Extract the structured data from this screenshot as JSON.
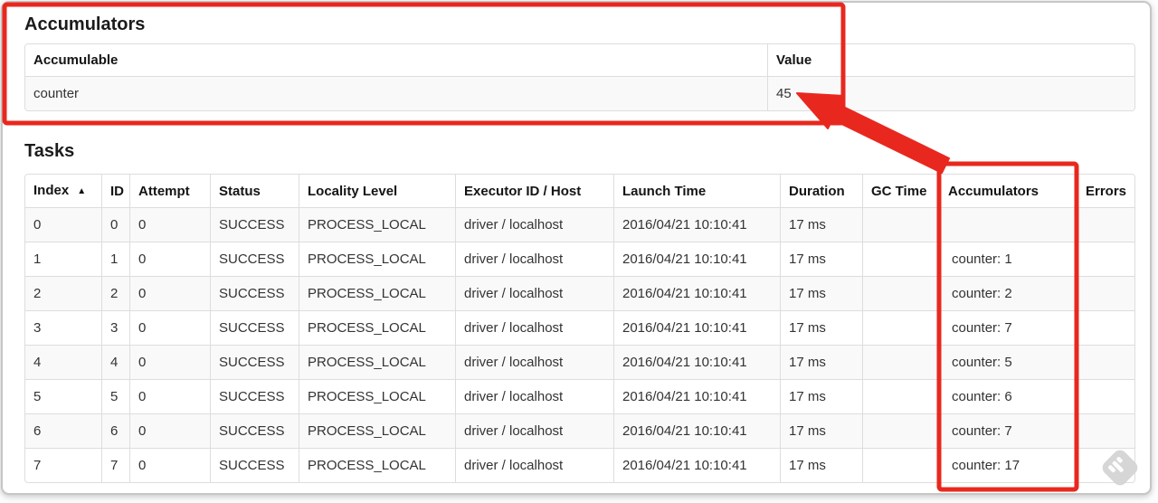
{
  "annotation": {
    "color": "#e8281e"
  },
  "watermark": {
    "name": "skitch-watermark"
  },
  "accumulators_section": {
    "heading": "Accumulators",
    "table": {
      "headers": {
        "accumulable": "Accumulable",
        "value": "Value"
      },
      "rows": [
        {
          "accumulable": "counter",
          "value": "45"
        }
      ]
    }
  },
  "tasks_section": {
    "heading": "Tasks",
    "table": {
      "sort_icon": "▲",
      "headers": {
        "index": "Index",
        "id": "ID",
        "attempt": "Attempt",
        "status": "Status",
        "locality": "Locality Level",
        "executor": "Executor ID / Host",
        "launch": "Launch Time",
        "duration": "Duration",
        "gc": "GC Time",
        "accumulators": "Accumulators",
        "errors": "Errors"
      },
      "rows": [
        {
          "index": "0",
          "id": "0",
          "attempt": "0",
          "status": "SUCCESS",
          "locality": "PROCESS_LOCAL",
          "executor": "driver / localhost",
          "launch": "2016/04/21 10:10:41",
          "duration": "17 ms",
          "gc": "",
          "accumulators": "",
          "errors": ""
        },
        {
          "index": "1",
          "id": "1",
          "attempt": "0",
          "status": "SUCCESS",
          "locality": "PROCESS_LOCAL",
          "executor": "driver / localhost",
          "launch": "2016/04/21 10:10:41",
          "duration": "17 ms",
          "gc": "",
          "accumulators": "counter: 1",
          "errors": ""
        },
        {
          "index": "2",
          "id": "2",
          "attempt": "0",
          "status": "SUCCESS",
          "locality": "PROCESS_LOCAL",
          "executor": "driver / localhost",
          "launch": "2016/04/21 10:10:41",
          "duration": "17 ms",
          "gc": "",
          "accumulators": "counter: 2",
          "errors": ""
        },
        {
          "index": "3",
          "id": "3",
          "attempt": "0",
          "status": "SUCCESS",
          "locality": "PROCESS_LOCAL",
          "executor": "driver / localhost",
          "launch": "2016/04/21 10:10:41",
          "duration": "17 ms",
          "gc": "",
          "accumulators": "counter: 7",
          "errors": ""
        },
        {
          "index": "4",
          "id": "4",
          "attempt": "0",
          "status": "SUCCESS",
          "locality": "PROCESS_LOCAL",
          "executor": "driver / localhost",
          "launch": "2016/04/21 10:10:41",
          "duration": "17 ms",
          "gc": "",
          "accumulators": "counter: 5",
          "errors": ""
        },
        {
          "index": "5",
          "id": "5",
          "attempt": "0",
          "status": "SUCCESS",
          "locality": "PROCESS_LOCAL",
          "executor": "driver / localhost",
          "launch": "2016/04/21 10:10:41",
          "duration": "17 ms",
          "gc": "",
          "accumulators": "counter: 6",
          "errors": ""
        },
        {
          "index": "6",
          "id": "6",
          "attempt": "0",
          "status": "SUCCESS",
          "locality": "PROCESS_LOCAL",
          "executor": "driver / localhost",
          "launch": "2016/04/21 10:10:41",
          "duration": "17 ms",
          "gc": "",
          "accumulators": "counter: 7",
          "errors": ""
        },
        {
          "index": "7",
          "id": "7",
          "attempt": "0",
          "status": "SUCCESS",
          "locality": "PROCESS_LOCAL",
          "executor": "driver / localhost",
          "launch": "2016/04/21 10:10:41",
          "duration": "17 ms",
          "gc": "",
          "accumulators": "counter: 17",
          "errors": ""
        }
      ]
    }
  }
}
